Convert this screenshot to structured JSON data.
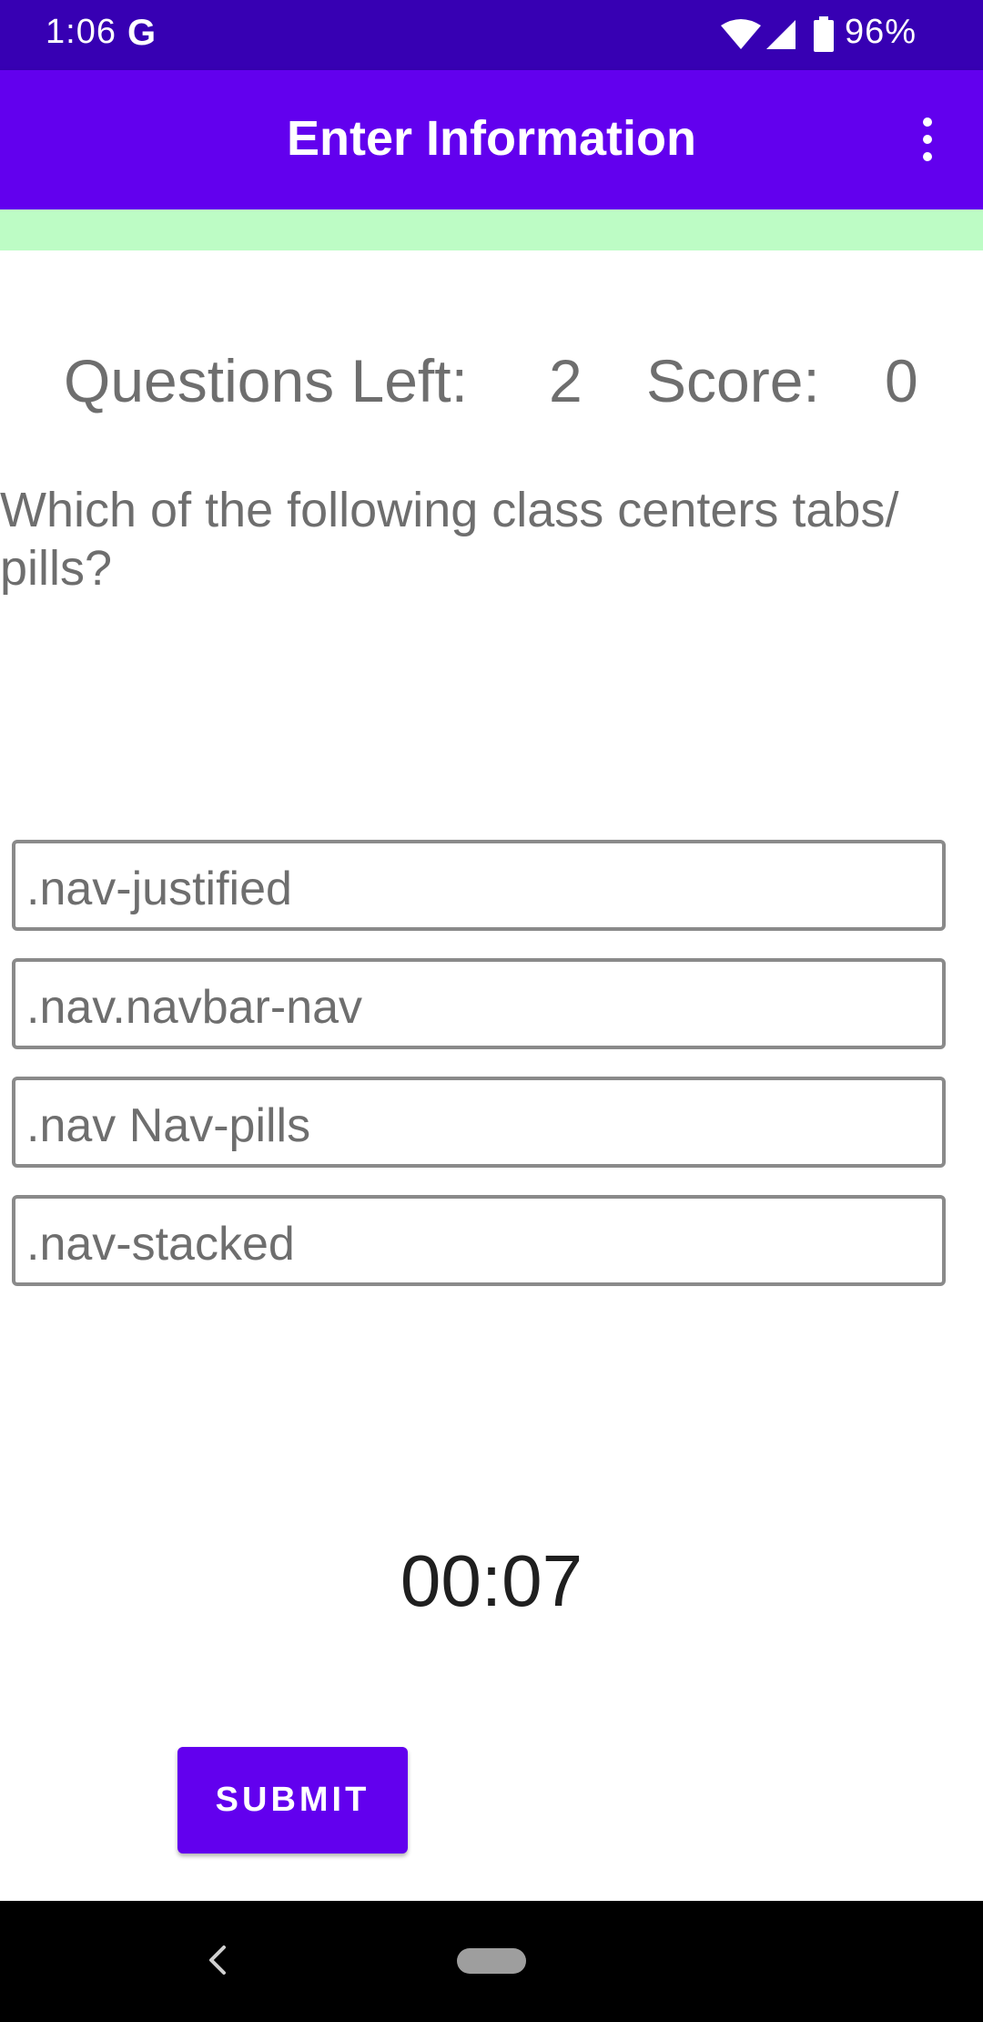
{
  "status_bar": {
    "time": "1:06",
    "g_icon": "google-g-icon",
    "battery": "96%",
    "icons": [
      "wifi-icon",
      "signal-icon",
      "battery-icon"
    ]
  },
  "app_bar": {
    "title": "Enter Information",
    "menu_icon": "overflow-menu-icon"
  },
  "scoreboard": {
    "questions_left_label": "Questions Left:",
    "questions_left_value": "2",
    "score_label": "Score:",
    "score_value": "0"
  },
  "question": {
    "text": "Which of the following class centers tabs/ pills?"
  },
  "options": [
    ".nav-justified",
    ".nav.navbar-nav",
    ".nav Nav-pills",
    ".nav-stacked"
  ],
  "timer": "00:07",
  "submit_label": "SUBMIT",
  "colors": {
    "status_bar": "#3700b3",
    "primary": "#6200ee",
    "progress_strip": "#bdfcc5",
    "text_gray": "#6e6e6e"
  }
}
